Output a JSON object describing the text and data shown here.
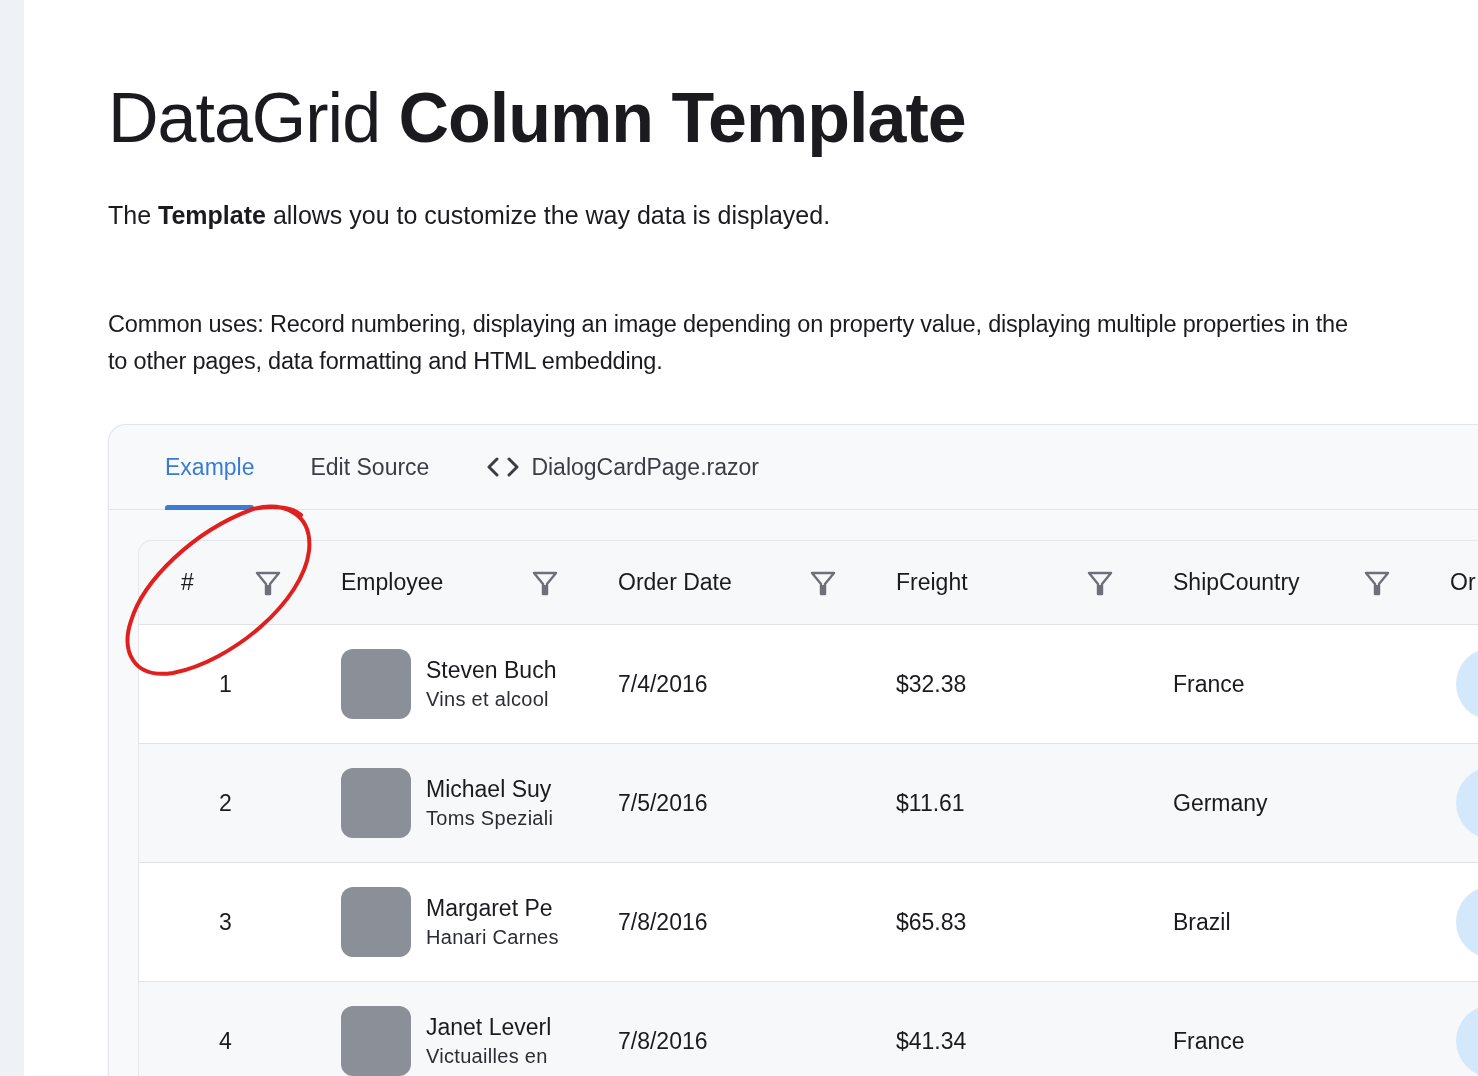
{
  "title": "DataGrid **Column Template**",
  "intro": "The **Template** allows you to customize the way data is displayed.",
  "common_uses_lines": [
    "Common uses: Record numbering, displaying an image depending on property value, displaying multiple properties in the",
    "to other pages, data formatting and HTML embedding."
  ],
  "tabs": [
    {
      "label": "Example",
      "kind": "text",
      "selected": true
    },
    {
      "label": "Edit Source",
      "kind": "text",
      "selected": false
    },
    {
      "label": "DialogCardPage.razor",
      "kind": "code",
      "selected": false
    }
  ],
  "grid": {
    "columns": [
      {
        "label": "#",
        "filterable": true
      },
      {
        "label": "Employee",
        "filterable": true
      },
      {
        "label": "Order Date",
        "filterable": true
      },
      {
        "label": "Freight",
        "filterable": true
      },
      {
        "label": "ShipCountry",
        "filterable": true
      },
      {
        "label": "Or",
        "filterable": false
      }
    ],
    "rows": [
      {
        "number": "1",
        "employee": "Steven Buch",
        "company": "Vins et alcool",
        "order_date": "7/4/2016",
        "freight": "$32.38",
        "ship_country": "France"
      },
      {
        "number": "2",
        "employee": "Michael Suy",
        "company": "Toms Speziali",
        "order_date": "7/5/2016",
        "freight": "$11.61",
        "ship_country": "Germany"
      },
      {
        "number": "3",
        "employee": "Margaret Pe",
        "company": "Hanari Carnes",
        "order_date": "7/8/2016",
        "freight": "$65.83",
        "ship_country": "Brazil"
      },
      {
        "number": "4",
        "employee": "Janet Leverl",
        "company": "Victuailles en",
        "order_date": "7/8/2016",
        "freight": "$41.34",
        "ship_country": "France"
      }
    ]
  },
  "highlight": {
    "kind": "hand-drawn-circle"
  }
}
